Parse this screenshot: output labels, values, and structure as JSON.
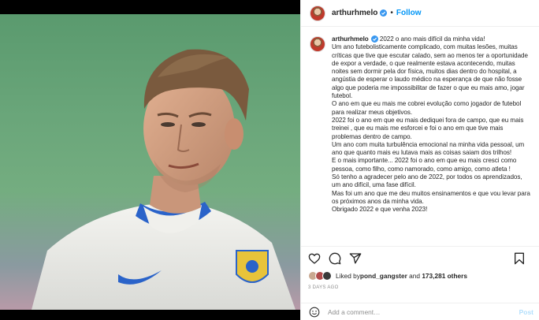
{
  "post": {
    "author": "arthurhmelo",
    "follow_label": "Follow",
    "separator": "•",
    "verified_icon": "verified-badge-icon"
  },
  "caption": {
    "username": "arthurhmelo",
    "text": " 2022 o ano mais difícil da minha vida!\nUm ano futebolisticamente complicado, com muitas lesões, muitas críticas que tive que escutar calado, sem ao menos ter a oportunidade de expor a verdade, o que realmente estava acontecendo, muitas noites sem dormir pela dor física, muitos dias dentro do hospital, a angústia de esperar o laudo médico na esperança de que não fosse algo que poderia me impossibilitar de fazer o que eu mais amo, jogar futebol.\nO ano em que eu mais me cobrei evolução como jogador de futebol para realizar meus objetivos.\n2022 foi o ano em que eu mais dediquei fora de campo, que eu mais treinei , que eu mais me esforcei e foi o ano em que tive mais problemas dentro de campo.\nUm ano com muita turbulência emocional na minha vida pessoal, um ano que quanto mais eu lutava mais as coisas saiam dos trilhos!\nE o mais importante... 2022 foi o ano em que eu mais cresci como pessoa, como filho, como namorado, como amigo, como atleta !\nSó tenho a agradecer pelo ano de 2022, por todos os aprendizados, um ano difícil, uma fase difícil.\nMas foi um ano que me deu muitos ensinamentos e que vou levar para os próximos anos da minha vida.\nObrigado 2022 e que venha 2023!"
  },
  "actions": {
    "icons": [
      "heart-icon",
      "comment-icon",
      "share-icon",
      "bookmark-icon"
    ]
  },
  "likes": {
    "prefix": "Liked by ",
    "user": "pond_gangster",
    "middle": " and ",
    "count": "173,281 others"
  },
  "timestamp": "3 DAYS AGO",
  "comment": {
    "placeholder": "Add a comment…",
    "post_label": "Post"
  },
  "colors": {
    "link_blue": "#0095f6",
    "post_disabled": "#b2dffc",
    "muted": "#8e8e8e"
  }
}
